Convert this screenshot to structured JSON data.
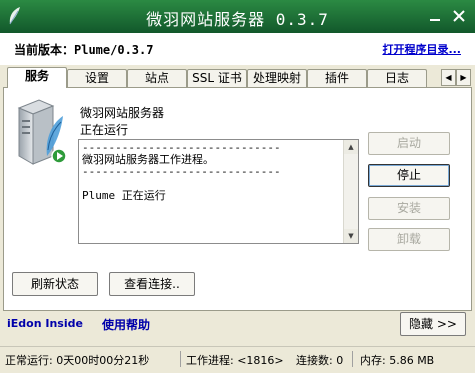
{
  "window": {
    "title": "微羽网站服务器 0.3.7",
    "minimize_glyph": "—",
    "close_glyph": "×"
  },
  "header": {
    "version_text": "当前版本：Plume/0.3.7",
    "open_dir_link": "打开程序目录..."
  },
  "tabs": [
    {
      "label": "服务",
      "active": true
    },
    {
      "label": "设置"
    },
    {
      "label": "站点"
    },
    {
      "label": "SSL 证书"
    },
    {
      "label": "处理映射"
    },
    {
      "label": "插件"
    },
    {
      "label": "日志"
    }
  ],
  "tab_scroll": {
    "left": "◀",
    "right": "▶"
  },
  "service": {
    "name": "微羽网站服务器",
    "status": "正在运行",
    "log_text": "------------------------------\n微羽网站服务器工作进程。\n------------------------------\n\nPlume 正在运行"
  },
  "side_buttons": {
    "start": "启动",
    "stop": "停止",
    "install": "安装",
    "uninstall": "卸载"
  },
  "bottom_buttons": {
    "refresh": "刷新状态",
    "view_connections": "查看连接.."
  },
  "footer": {
    "link_inside": "iEdon Inside",
    "link_help": "使用帮助",
    "hide_button": "隐藏 >>"
  },
  "statusbar": {
    "uptime": "正常运行: 0天00时00分21秒",
    "worker": "工作进程: <1816>",
    "connections": "连接数: 0",
    "memory": "内存: 5.86 MB"
  },
  "colors": {
    "title_bar": "#1e7238",
    "link": "#0000aa"
  }
}
